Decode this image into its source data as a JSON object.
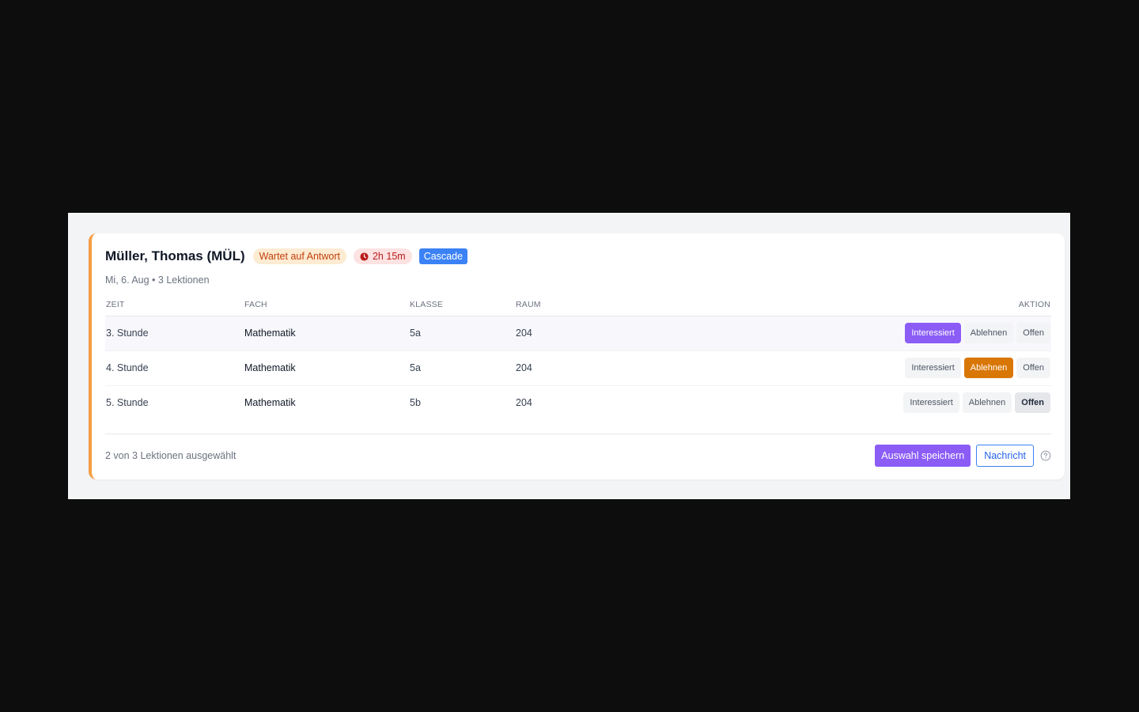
{
  "card": {
    "teacher_name": "Müller, Thomas (MÜL)",
    "status_badge": "Wartet auf Antwort",
    "timer_badge": "2h 15m",
    "mode_badge": "Cascade",
    "subtitle": "Mi, 6. Aug • 3 Lektionen",
    "accent_color": "#f59e42"
  },
  "table": {
    "headers": {
      "zeit": "ZEIT",
      "fach": "FACH",
      "klasse": "KLASSE",
      "raum": "RAUM",
      "aktion": "AKTION"
    },
    "action_labels": {
      "interested": "Interessiert",
      "decline": "Ablehnen",
      "open": "Offen"
    },
    "rows": [
      {
        "zeit": "3. Stunde",
        "fach": "Mathematik",
        "klasse": "5a",
        "raum": "204",
        "selected": "interested"
      },
      {
        "zeit": "4. Stunde",
        "fach": "Mathematik",
        "klasse": "5a",
        "raum": "204",
        "selected": "decline"
      },
      {
        "zeit": "5. Stunde",
        "fach": "Mathematik",
        "klasse": "5b",
        "raum": "204",
        "selected": "open"
      }
    ]
  },
  "footer": {
    "summary": "2 von 3 Lektionen ausgewählt",
    "save_label": "Auswahl speichern",
    "message_label": "Nachricht"
  },
  "colors": {
    "interested": "#8b5cf6",
    "decline": "#d97706",
    "cascade": "#3b82f6",
    "waiting_bg": "#fdebd2",
    "timer_bg": "#fde2e2"
  }
}
